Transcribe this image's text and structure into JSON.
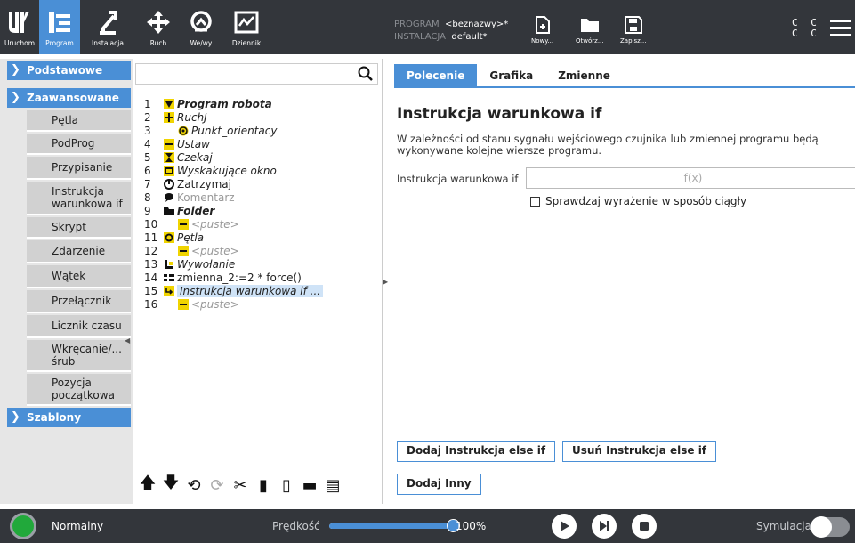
{
  "topbar": {
    "buttons": [
      {
        "label": "Uruchom",
        "icon": "ur-logo-icon"
      },
      {
        "label": "Program",
        "icon": "program-icon"
      },
      {
        "label": "Instalacja",
        "icon": "robot-arm-icon"
      },
      {
        "label": "Ruch",
        "icon": "move-arrows-icon"
      },
      {
        "label": "We/wy",
        "icon": "io-icon"
      },
      {
        "label": "Dziennik",
        "icon": "log-chart-icon"
      }
    ],
    "program_label": "PROGRAM",
    "program_value": "<beznazwy>*",
    "install_label": "INSTALACJA",
    "install_value": "default*",
    "file_buttons": [
      {
        "label": "Nowy...",
        "icon": "new-file-icon"
      },
      {
        "label": "Otwórz...",
        "icon": "open-folder-icon"
      },
      {
        "label": "Zapisz...",
        "icon": "save-icon"
      }
    ],
    "cc_top": "C C",
    "cc_bottom": "C C"
  },
  "left_panel": {
    "categories": [
      {
        "label": "Podstawowe",
        "expanded": false
      },
      {
        "label": "Zaawansowane",
        "expanded": true
      },
      {
        "label": "Szablony",
        "expanded": false
      }
    ],
    "advanced_items": [
      "Pętla",
      "PodProg",
      "Przypisanie",
      "Instrukcja warunkowa if",
      "Skrypt",
      "Zdarzenie",
      "Wątek",
      "Przełącznik",
      "Licznik czasu",
      "Wkręcanie/... śrub",
      "Pozycja początkowa"
    ]
  },
  "tree": {
    "search_placeholder": "",
    "lines": [
      {
        "num": "1",
        "text": "Program robota",
        "icon": "triangle-down-icon"
      },
      {
        "num": "2",
        "text": "RuchJ",
        "icon": "move-icon"
      },
      {
        "num": "3",
        "text": "Punkt_orientacy",
        "icon": "waypoint-icon"
      },
      {
        "num": "4",
        "text": "Ustaw",
        "icon": "set-icon"
      },
      {
        "num": "5",
        "text": "Czekaj",
        "icon": "hourglass-icon"
      },
      {
        "num": "6",
        "text": "Wyskakujące okno",
        "icon": "popup-icon"
      },
      {
        "num": "7",
        "text": "Zatrzymaj",
        "icon": "stop-icon"
      },
      {
        "num": "8",
        "text": "Komentarz",
        "icon": "comment-icon"
      },
      {
        "num": "9",
        "text": "Folder",
        "icon": "folder-icon"
      },
      {
        "num": "10",
        "text": "<puste>",
        "icon": "empty-icon"
      },
      {
        "num": "11",
        "text": "Pętla",
        "icon": "loop-icon"
      },
      {
        "num": "12",
        "text": "<puste>",
        "icon": "empty-icon"
      },
      {
        "num": "13",
        "text": "Wywołanie",
        "icon": "call-icon"
      },
      {
        "num": "14",
        "text": "zmienna_2:=2 * force()",
        "icon": "assign-icon"
      },
      {
        "num": "15",
        "text": "Instrukcja warunkowa if ...",
        "icon": "if-icon"
      },
      {
        "num": "16",
        "text": "<puste>",
        "icon": "empty-icon"
      }
    ]
  },
  "right_panel": {
    "tabs": [
      "Polecenie",
      "Grafika",
      "Zmienne"
    ],
    "title": "Instrukcja warunkowa if",
    "description": "W zależności od stanu sygnału wejściowego czujnika lub zmiennej programu będą wykonywane kolejne wiersze programu.",
    "cond_label": "Instrukcja warunkowa if",
    "cond_placeholder": "f(x)",
    "check_label": "Sprawdzaj wyrażenie w sposób ciągły",
    "btn_add_elseif": "Dodaj Instrukcja else if",
    "btn_remove_elseif": "Usuń Instrukcja else if",
    "btn_add_else": "Dodaj Inny"
  },
  "bottom": {
    "status": "Normalny",
    "speed_label": "Prędkość",
    "speed_value": "100%",
    "speed_fraction": 1.0,
    "sim_label": "Symulacja"
  },
  "colors": {
    "accent": "#4a8fd6",
    "topbar": "#33363b",
    "status_ok": "#21a93b"
  }
}
